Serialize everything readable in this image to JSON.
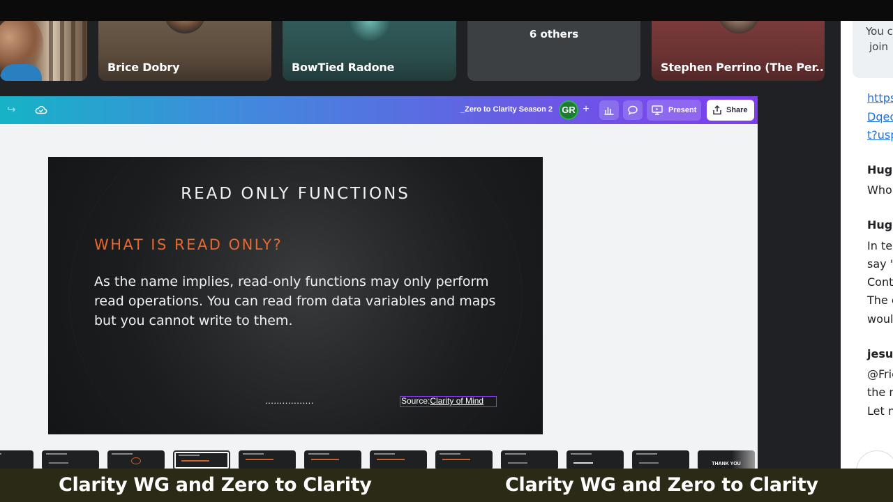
{
  "participants": [
    {
      "name": ""
    },
    {
      "name": "Brice Dobry"
    },
    {
      "name": "BowTied Radone"
    },
    {
      "others_label": "6 others"
    },
    {
      "name": "Stephen Perrino (The Per..."
    }
  ],
  "chat": {
    "system_lines": [
      "You c",
      "join"
    ],
    "link_lines": [
      "https",
      "Dqeo",
      "t?usp"
    ],
    "messages": [
      {
        "sender": "Hugo",
        "lines": [
          "Who"
        ]
      },
      {
        "sender": "Hugo",
        "lines": [
          "In te",
          "say \"",
          "Cont",
          "The c",
          "woul"
        ]
      },
      {
        "sender": "jesus",
        "lines": [
          "@Frie",
          "the n",
          "Let n"
        ]
      }
    ]
  },
  "editor": {
    "doc_title": "_Zero to Clarity Season 2",
    "collaborator_initials": "GR",
    "add_label": "+",
    "present_label": "Present",
    "share_label": "Share",
    "redo_glyph": "↪"
  },
  "slide": {
    "title": "READ ONLY FUNCTIONS",
    "subtitle": "WHAT IS READ ONLY?",
    "body": "As the name implies, read-only functions may only perform read operations. You can read from data variables and maps but you cannot write to them.",
    "dots": ".................",
    "source_prefix": "Source:",
    "source_link": "Clarity of Mind"
  },
  "thumbnails": [
    {
      "label": ""
    },
    {
      "label": ""
    },
    {
      "label": ""
    },
    {
      "label": "",
      "active": true
    },
    {
      "label": ""
    },
    {
      "label": ""
    },
    {
      "label": ""
    },
    {
      "label": ""
    },
    {
      "label": ""
    },
    {
      "label": ""
    },
    {
      "label": ""
    },
    {
      "label": "THANK YOU"
    }
  ],
  "captions": {
    "left": "Clarity WG and Zero to Clarity",
    "right": "Clarity WG and Zero to Clarity"
  },
  "colors": {
    "accent_orange": "#e8682d",
    "canva_purple": "#7d3ef0",
    "canva_teal": "#16b3c6",
    "gr_green": "#1e7a35",
    "caption_bg": "#2b2a17"
  }
}
